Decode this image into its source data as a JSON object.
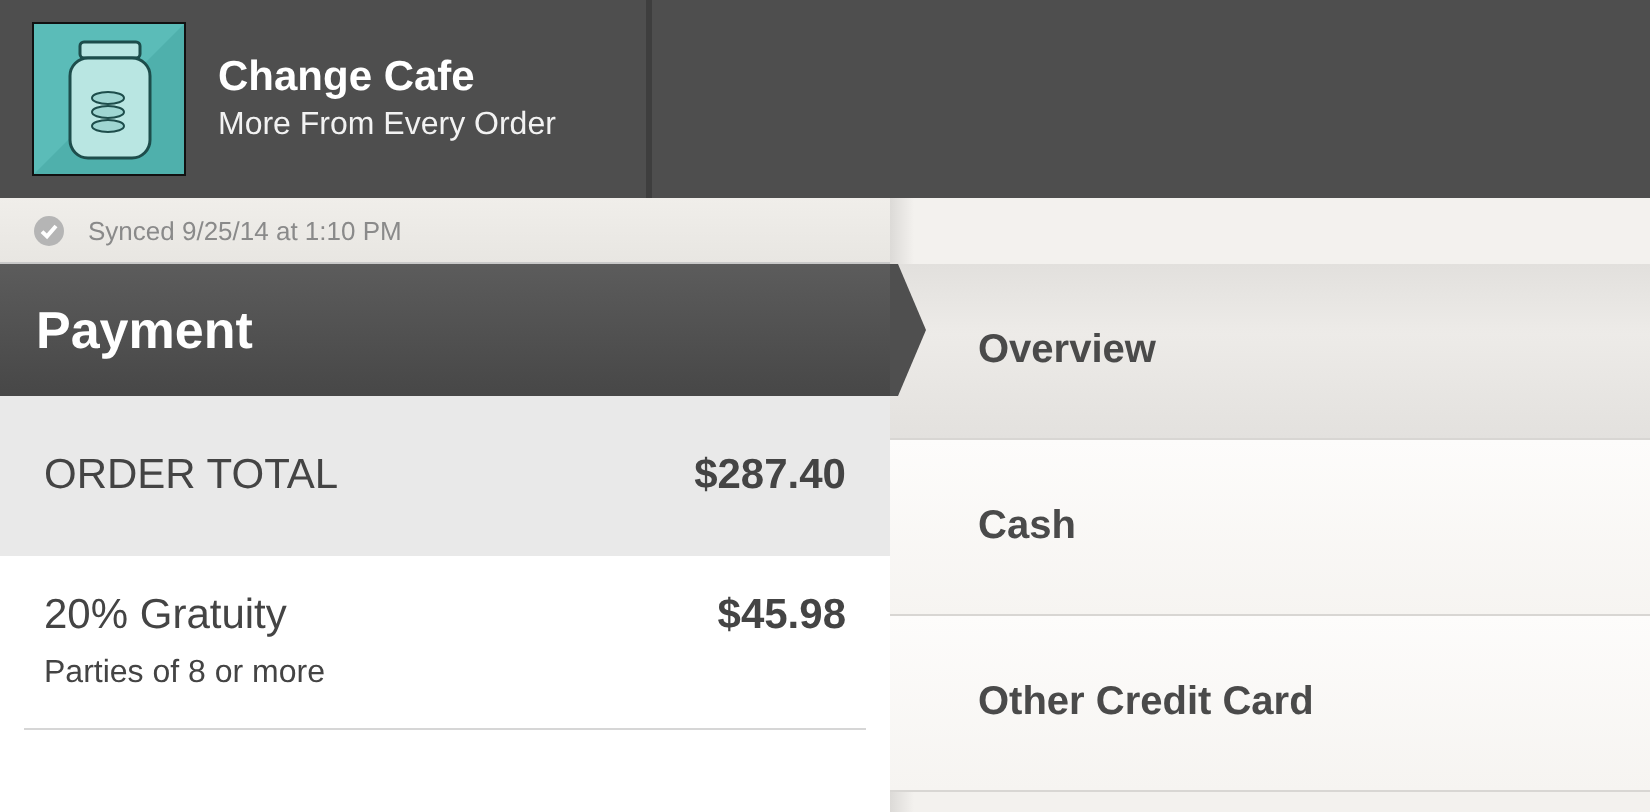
{
  "header": {
    "title": "Change Cafe",
    "subtitle": "More From Every Order"
  },
  "sync": {
    "text": "Synced 9/25/14 at 1:10 PM"
  },
  "payment": {
    "title": "Payment",
    "total": {
      "label": "ORDER TOTAL",
      "amount": "$287.40"
    },
    "lines": [
      {
        "label": "20% Gratuity",
        "amount": "$45.98",
        "note": "Parties of 8 or more"
      }
    ]
  },
  "methods": [
    {
      "label": "Overview",
      "selected": true
    },
    {
      "label": "Cash",
      "selected": false
    },
    {
      "label": "Other Credit Card",
      "selected": false
    }
  ]
}
